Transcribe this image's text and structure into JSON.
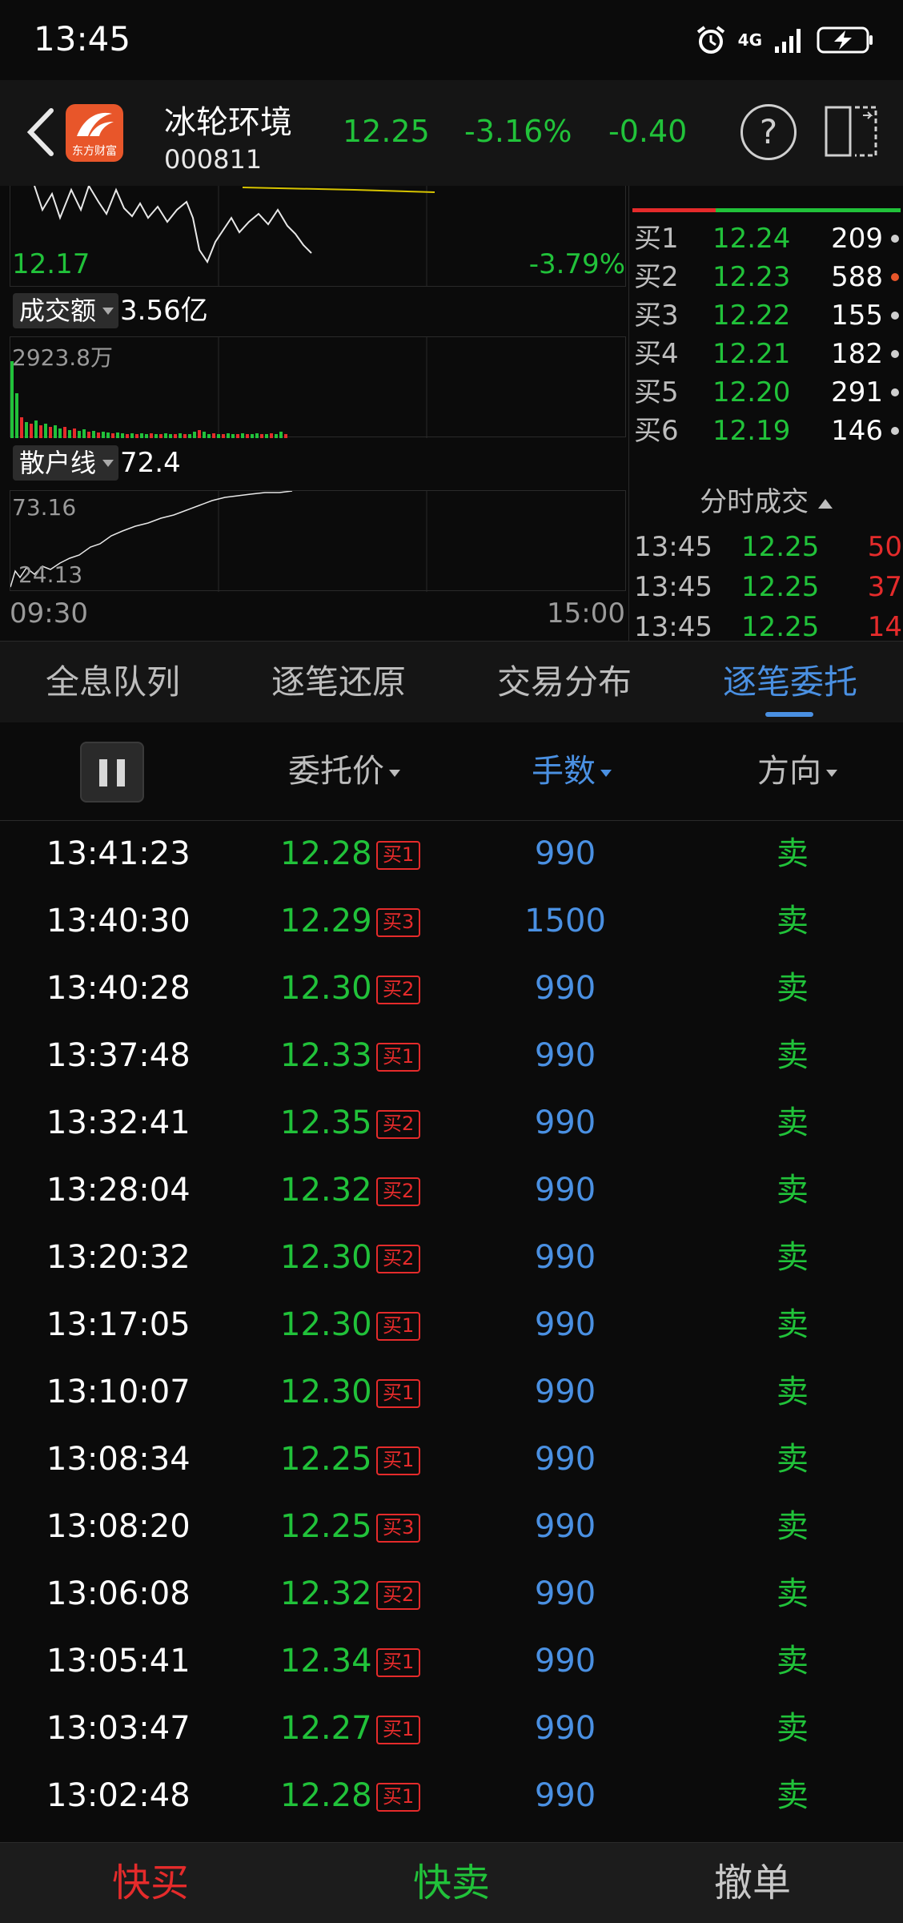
{
  "status": {
    "time": "13:45",
    "network": "4G"
  },
  "header": {
    "name": "冰轮环境",
    "code": "000811",
    "price": "12.25",
    "change_pct": "-3.16%",
    "change": "-0.40",
    "help": "?",
    "logo_text": "东方财富"
  },
  "chart": {
    "price_low": "12.17",
    "price_low_pct": "-3.79%",
    "volume_chip": "成交额",
    "volume_value": "3.56亿",
    "volume_max": "2923.8万",
    "retail_chip": "散户线",
    "retail_value": "72.4",
    "retail_max": "73.16",
    "retail_min": "24.13",
    "time_start": "09:30",
    "time_end": "15:00"
  },
  "order_book": {
    "bids": [
      {
        "label": "买1",
        "price": "12.24",
        "vol": "209",
        "dot": "#cfcfcf"
      },
      {
        "label": "买2",
        "price": "12.23",
        "vol": "588",
        "dot": "#e8562a"
      },
      {
        "label": "买3",
        "price": "12.22",
        "vol": "155",
        "dot": "#cfcfcf"
      },
      {
        "label": "买4",
        "price": "12.21",
        "vol": "182",
        "dot": "#cfcfcf"
      },
      {
        "label": "买5",
        "price": "12.20",
        "vol": "291",
        "dot": "#cfcfcf"
      },
      {
        "label": "买6",
        "price": "12.19",
        "vol": "146",
        "dot": "#cfcfcf"
      }
    ],
    "trades_title": "分时成交",
    "trades": [
      {
        "time": "13:45",
        "price": "12.25",
        "vol": "50"
      },
      {
        "time": "13:45",
        "price": "12.25",
        "vol": "37"
      },
      {
        "time": "13:45",
        "price": "12.25",
        "vol": "14"
      }
    ]
  },
  "tabs": [
    "全息队列",
    "逐笔还原",
    "交易分布",
    "逐笔委托"
  ],
  "active_tab": 3,
  "columns": {
    "price": "委托价",
    "volume": "手数",
    "direction": "方向"
  },
  "rows": [
    {
      "time": "13:41:23",
      "price": "12.28",
      "tag": "买1",
      "vol": "990",
      "dir": "卖"
    },
    {
      "time": "13:40:30",
      "price": "12.29",
      "tag": "买3",
      "vol": "1500",
      "dir": "卖"
    },
    {
      "time": "13:40:28",
      "price": "12.30",
      "tag": "买2",
      "vol": "990",
      "dir": "卖"
    },
    {
      "time": "13:37:48",
      "price": "12.33",
      "tag": "买1",
      "vol": "990",
      "dir": "卖"
    },
    {
      "time": "13:32:41",
      "price": "12.35",
      "tag": "买2",
      "vol": "990",
      "dir": "卖"
    },
    {
      "time": "13:28:04",
      "price": "12.32",
      "tag": "买2",
      "vol": "990",
      "dir": "卖"
    },
    {
      "time": "13:20:32",
      "price": "12.30",
      "tag": "买2",
      "vol": "990",
      "dir": "卖"
    },
    {
      "time": "13:17:05",
      "price": "12.30",
      "tag": "买1",
      "vol": "990",
      "dir": "卖"
    },
    {
      "time": "13:10:07",
      "price": "12.30",
      "tag": "买1",
      "vol": "990",
      "dir": "卖"
    },
    {
      "time": "13:08:34",
      "price": "12.25",
      "tag": "买1",
      "vol": "990",
      "dir": "卖"
    },
    {
      "time": "13:08:20",
      "price": "12.25",
      "tag": "买3",
      "vol": "990",
      "dir": "卖"
    },
    {
      "time": "13:06:08",
      "price": "12.32",
      "tag": "买2",
      "vol": "990",
      "dir": "卖"
    },
    {
      "time": "13:05:41",
      "price": "12.34",
      "tag": "买1",
      "vol": "990",
      "dir": "卖"
    },
    {
      "time": "13:03:47",
      "price": "12.27",
      "tag": "买1",
      "vol": "990",
      "dir": "卖"
    },
    {
      "time": "13:02:48",
      "price": "12.28",
      "tag": "买1",
      "vol": "990",
      "dir": "卖"
    }
  ],
  "bottom": {
    "buy": "快买",
    "sell": "快卖",
    "cancel": "撤单"
  },
  "colors": {
    "up": "#e52b2b",
    "down": "#21c23a",
    "accent": "#4a90e2"
  }
}
